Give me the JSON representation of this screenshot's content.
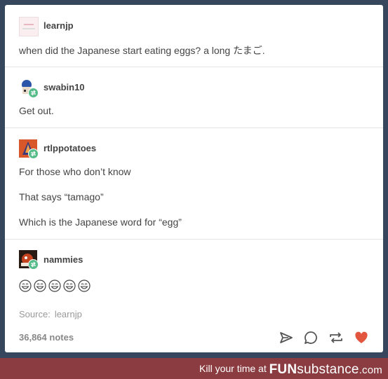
{
  "posts": [
    {
      "username": "learnjp",
      "text": "when did the Japanese start eating eggs? a long たまご."
    },
    {
      "username": "swabin10",
      "text": "Get out."
    },
    {
      "username": "rtlppotatoes",
      "lines": [
        "For those who don’t know",
        "That says “tamago”",
        "Which is the Japanese word for “egg”"
      ]
    },
    {
      "username": "nammies",
      "emoji_count": 5
    }
  ],
  "source": {
    "label": "Source:",
    "value": "learnjp"
  },
  "notes": "36,864 notes",
  "action_icons": [
    "send-icon",
    "reply-icon",
    "reblog-icon",
    "like-heart-icon"
  ],
  "colors": {
    "background": "#36465d",
    "heart": "#e2553f",
    "reblog_badge": "#56bc8a",
    "footer": "#8a3c41"
  },
  "footer": {
    "tagline": "Kill your time at",
    "brand_bold": "FUN",
    "brand_rest": "substance",
    "brand_suffix": ".com"
  }
}
